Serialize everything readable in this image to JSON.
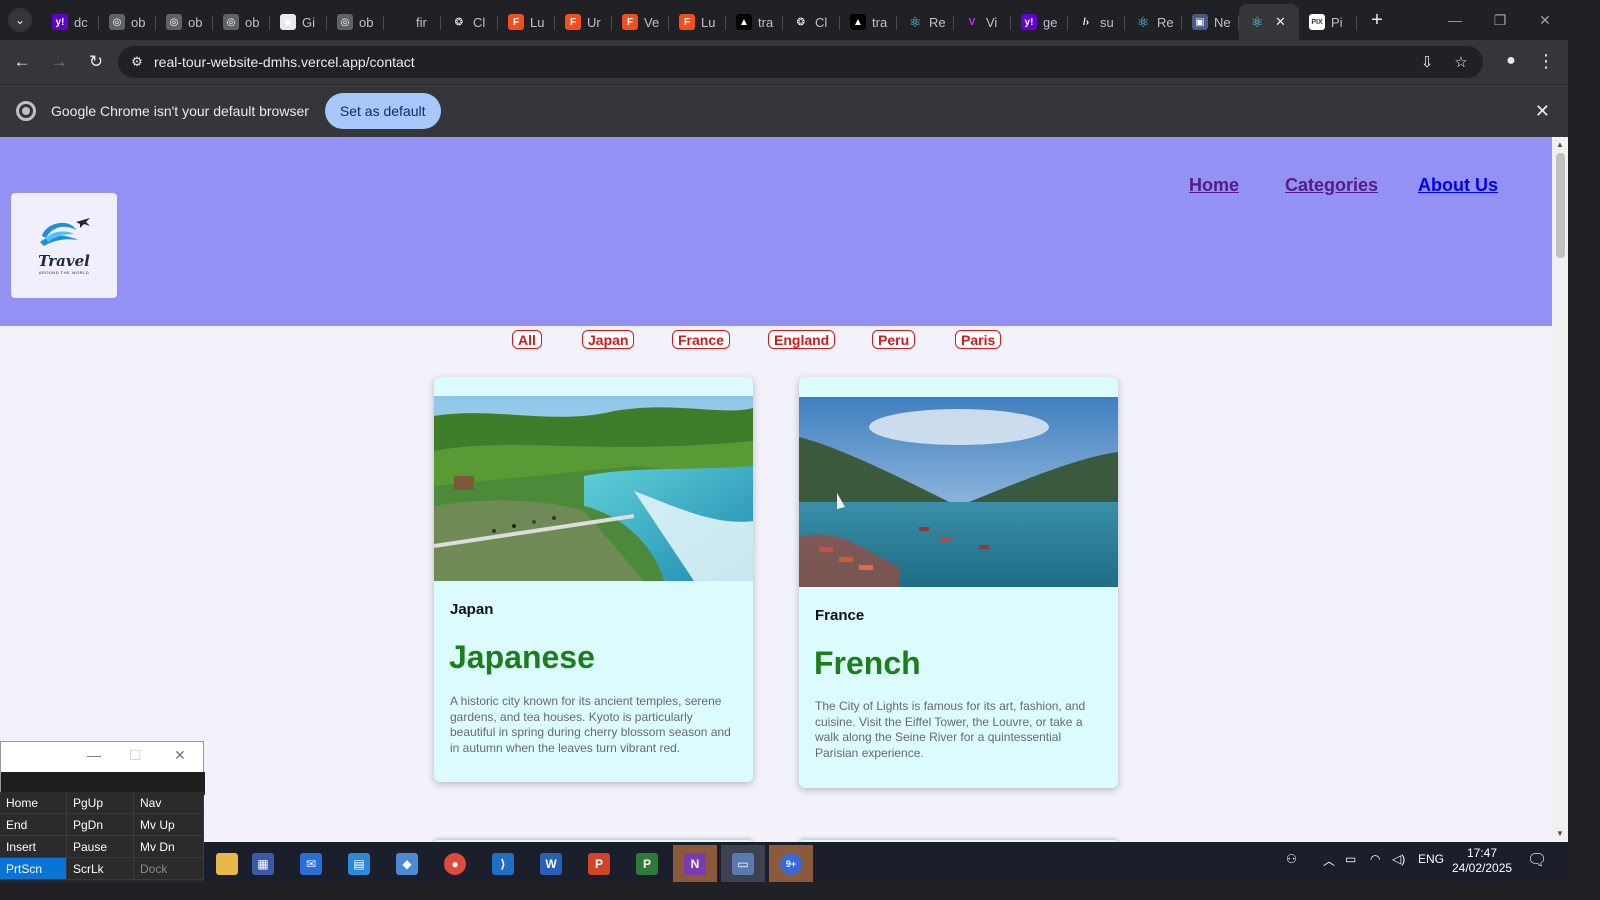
{
  "browser": {
    "tabs": [
      {
        "label": "dc",
        "favicon": "yahoo-icon",
        "color": "#6001d2"
      },
      {
        "label": "ob",
        "favicon": "globe-icon",
        "color": "#5f6368"
      },
      {
        "label": "ob",
        "favicon": "globe-icon",
        "color": "#5f6368"
      },
      {
        "label": "ob",
        "favicon": "globe-icon",
        "color": "#5f6368"
      },
      {
        "label": "Gi",
        "favicon": "diamond-icon",
        "color": "#e8eaed"
      },
      {
        "label": "ob",
        "favicon": "globe-icon",
        "color": "#5f6368"
      },
      {
        "label": "fir",
        "favicon": "blank-icon",
        "color": "#202124"
      },
      {
        "label": "Cl",
        "favicon": "openai-icon",
        "color": "#202124"
      },
      {
        "label": "Lu",
        "favicon": "figma-icon",
        "color": "#f24e1e"
      },
      {
        "label": "Ur",
        "favicon": "figma-icon",
        "color": "#f24e1e"
      },
      {
        "label": "Ve",
        "favicon": "figma-icon",
        "color": "#f24e1e"
      },
      {
        "label": "Lu",
        "favicon": "figma-icon",
        "color": "#f24e1e"
      },
      {
        "label": "tra",
        "favicon": "vercel-icon",
        "color": "#000000"
      },
      {
        "label": "Cl",
        "favicon": "openai-icon",
        "color": "#202124"
      },
      {
        "label": "tra",
        "favicon": "vercel-icon",
        "color": "#000000"
      },
      {
        "label": "Re",
        "favicon": "react-icon",
        "color": "#202124"
      },
      {
        "label": "Vi",
        "favicon": "vite-icon",
        "color": "#202124"
      },
      {
        "label": "ge",
        "favicon": "yahoo-icon",
        "color": "#6001d2"
      },
      {
        "label": "su",
        "favicon": "terminal-icon",
        "color": "#202124"
      },
      {
        "label": "Re",
        "favicon": "react-icon",
        "color": "#202124"
      },
      {
        "label": "Ne",
        "favicon": "image-icon",
        "color": "#4a5a8a"
      }
    ],
    "active_tab": {
      "favicon": "react-icon"
    },
    "last_tab": {
      "label": "Pi",
      "favicon": "pix-icon"
    },
    "url": "real-tour-website-dmhs.vercel.app/contact",
    "infobar_text": "Google Chrome isn't your default browser",
    "set_default_label": "Set as default"
  },
  "page": {
    "nav": {
      "home": "Home",
      "categories": "Categories",
      "about": "About Us"
    },
    "logo": {
      "word": "Travel",
      "sub": "AROUND THE WORLD"
    },
    "filters": [
      "All",
      "Japan",
      "France",
      "England",
      "Peru",
      "Paris"
    ],
    "cards": [
      {
        "country": "Japan",
        "title": "Japanese",
        "description": "A historic city known for its ancient temples, serene gardens, and tea houses. Kyoto is particularly beautiful in spring during cherry blossom season and in autumn when the leaves turn vibrant red.",
        "image": "waterfall-photo"
      },
      {
        "country": "France",
        "title": "French",
        "description": "The City of Lights is famous for its art, fashion, and cuisine. Visit the Eiffel Tower, the Louvre, or take a walk along the Seine River for a quintessential Parisian experience.",
        "image": "lake-photo"
      }
    ],
    "header_color": "#9392f4",
    "title_color": "#1d7d1d",
    "filter_color": "#d11a1a"
  },
  "keypad": {
    "keys": [
      "Home",
      "PgUp",
      "Nav",
      "End",
      "PgDn",
      "Mv Up",
      "Insert",
      "Pause",
      "Mv Dn",
      "PrtScn",
      "ScrLk",
      "Dock"
    ]
  },
  "taskbar": {
    "lang": "ENG",
    "time": "17:47",
    "date": "24/02/2025",
    "badge": "9+"
  }
}
